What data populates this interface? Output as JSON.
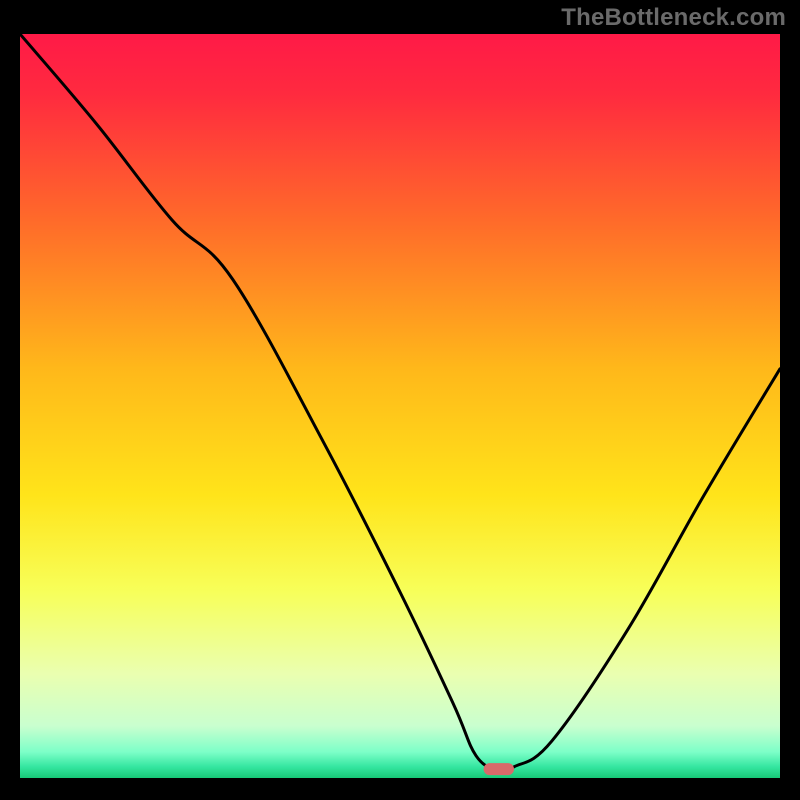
{
  "watermark": "TheBottleneck.com",
  "chart_data": {
    "type": "line",
    "title": "",
    "xlabel": "",
    "ylabel": "",
    "xlim": [
      0,
      100
    ],
    "ylim": [
      0,
      100
    ],
    "x": [
      0,
      10,
      20,
      28,
      40,
      50,
      57,
      60,
      63,
      65,
      70,
      80,
      90,
      100
    ],
    "values": [
      100,
      88,
      75,
      67,
      45,
      25,
      10,
      3,
      1,
      1.5,
      5,
      20,
      38,
      55
    ],
    "min_marker": {
      "x_start": 61,
      "x_end": 65,
      "y": 1.2
    },
    "gradient_stops": [
      {
        "offset": 0.0,
        "color": "#ff1a47"
      },
      {
        "offset": 0.08,
        "color": "#ff2a3f"
      },
      {
        "offset": 0.25,
        "color": "#ff6a2a"
      },
      {
        "offset": 0.45,
        "color": "#ffb81a"
      },
      {
        "offset": 0.62,
        "color": "#ffe41a"
      },
      {
        "offset": 0.75,
        "color": "#f7ff5a"
      },
      {
        "offset": 0.86,
        "color": "#eaffb0"
      },
      {
        "offset": 0.93,
        "color": "#c9ffcf"
      },
      {
        "offset": 0.965,
        "color": "#7dffc8"
      },
      {
        "offset": 0.985,
        "color": "#35e6a0"
      },
      {
        "offset": 1.0,
        "color": "#17c877"
      }
    ]
  }
}
